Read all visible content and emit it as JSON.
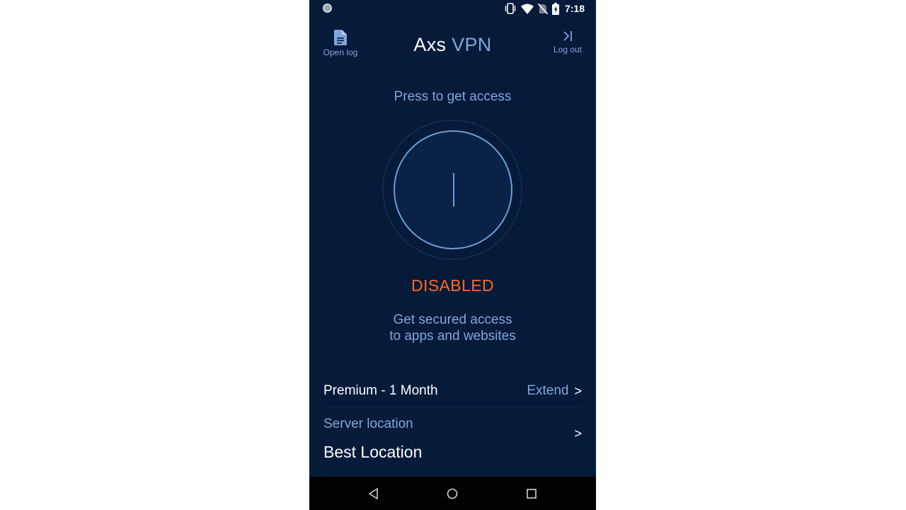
{
  "status_bar": {
    "time": "7:18"
  },
  "header": {
    "open_log_label": "Open log",
    "logout_label": "Log out",
    "title_part1": "Axs",
    "title_part2": "VPN"
  },
  "main": {
    "prompt": "Press to get access",
    "status": "DISABLED",
    "description_line1": "Get secured access",
    "description_line2": "to apps and websites"
  },
  "plan": {
    "name": "Premium - 1 Month",
    "extend_label": "Extend",
    "chevron": ">"
  },
  "server": {
    "label": "Server location",
    "value": "Best Location",
    "chevron": ">"
  },
  "colors": {
    "background": "#061a3a",
    "accent": "#7fa7d8",
    "status_disabled": "#ff6a1f",
    "text": "#ffffff"
  },
  "icons": [
    "document-icon",
    "logout-icon",
    "power-icon",
    "vibrate-icon",
    "wifi-icon",
    "no-sim-icon",
    "battery-icon",
    "back-icon",
    "home-icon",
    "recents-icon"
  ]
}
